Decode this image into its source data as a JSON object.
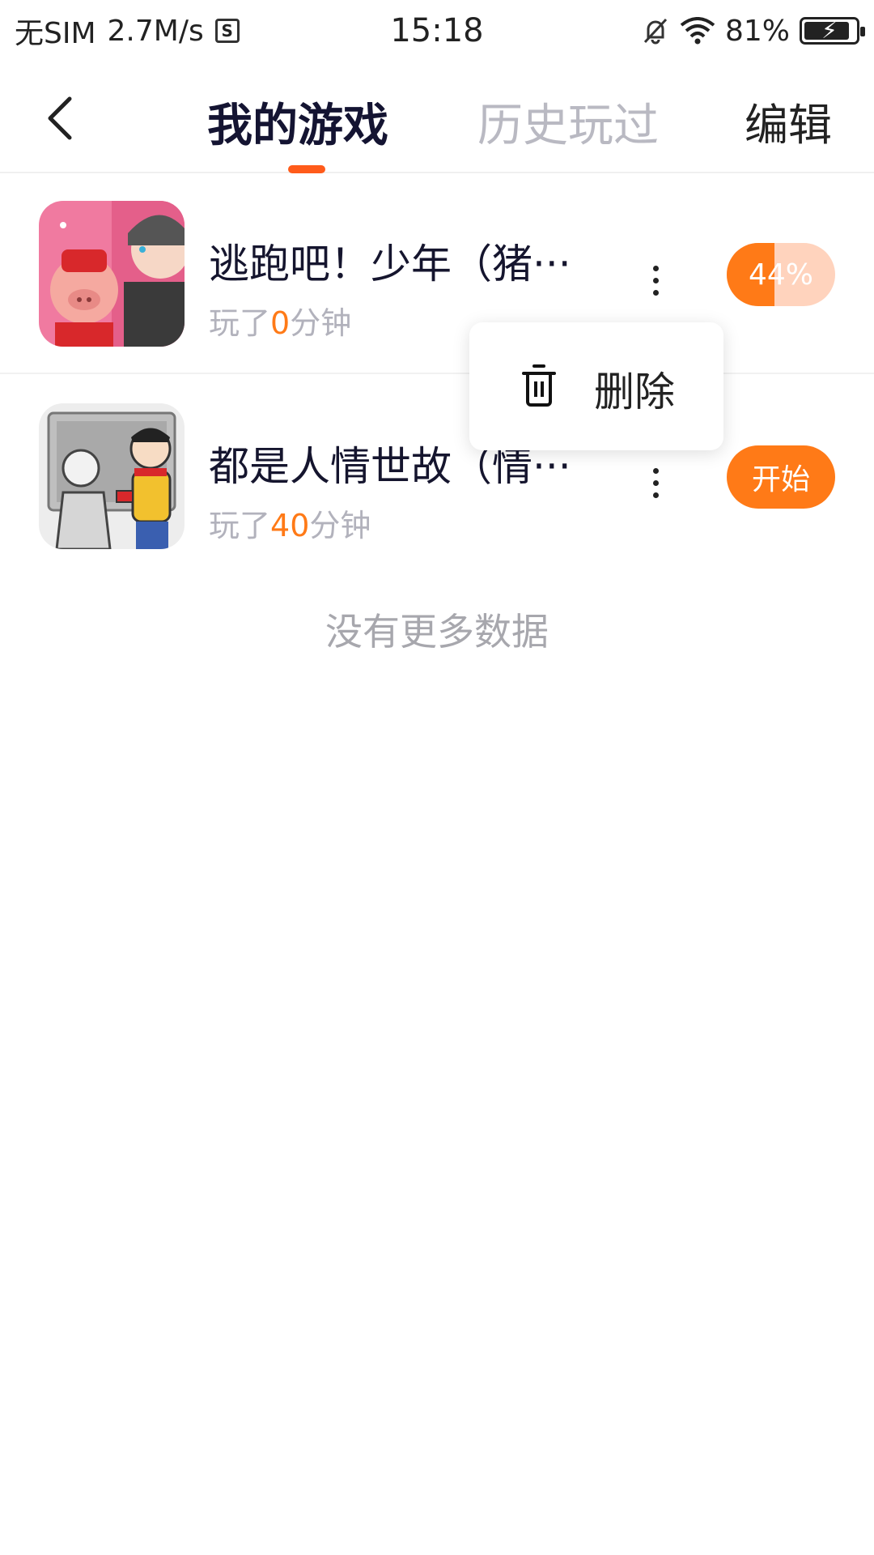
{
  "status_bar": {
    "carrier": "无SIM",
    "speed": "2.7M/s",
    "sim_icon_letter": "S",
    "time": "15:18",
    "battery": "81%",
    "icons": [
      "sim-card-icon",
      "bell-off-icon",
      "wifi-icon",
      "battery-charging-icon"
    ]
  },
  "header": {
    "back_icon": "chevron-left-icon",
    "tabs": [
      {
        "label": "我的游戏",
        "active": true
      },
      {
        "label": "历史玩过",
        "active": false
      }
    ],
    "edit_label": "编辑",
    "accent_color": "#ff5b1a"
  },
  "games": [
    {
      "name": "逃跑吧！少年（猪···",
      "played_prefix": "玩了",
      "played_minutes": "0",
      "played_suffix": "分钟",
      "action_label": "44%",
      "progress": 0.44,
      "icon": "pig-and-boy-game-icon"
    },
    {
      "name": "都是人情世故（情···",
      "played_prefix": "玩了",
      "played_minutes": "40",
      "played_suffix": "分钟",
      "action_label": "开始",
      "icon": "cartoon-redenvelope-game-icon"
    }
  ],
  "popup_menu": {
    "icon": "trash-icon",
    "label": "删除"
  },
  "footer_text": "没有更多数据",
  "colors": {
    "orange": "#ff7a17",
    "progress_track": "#ffd3bd",
    "muted_text": "#b2b2bc"
  }
}
